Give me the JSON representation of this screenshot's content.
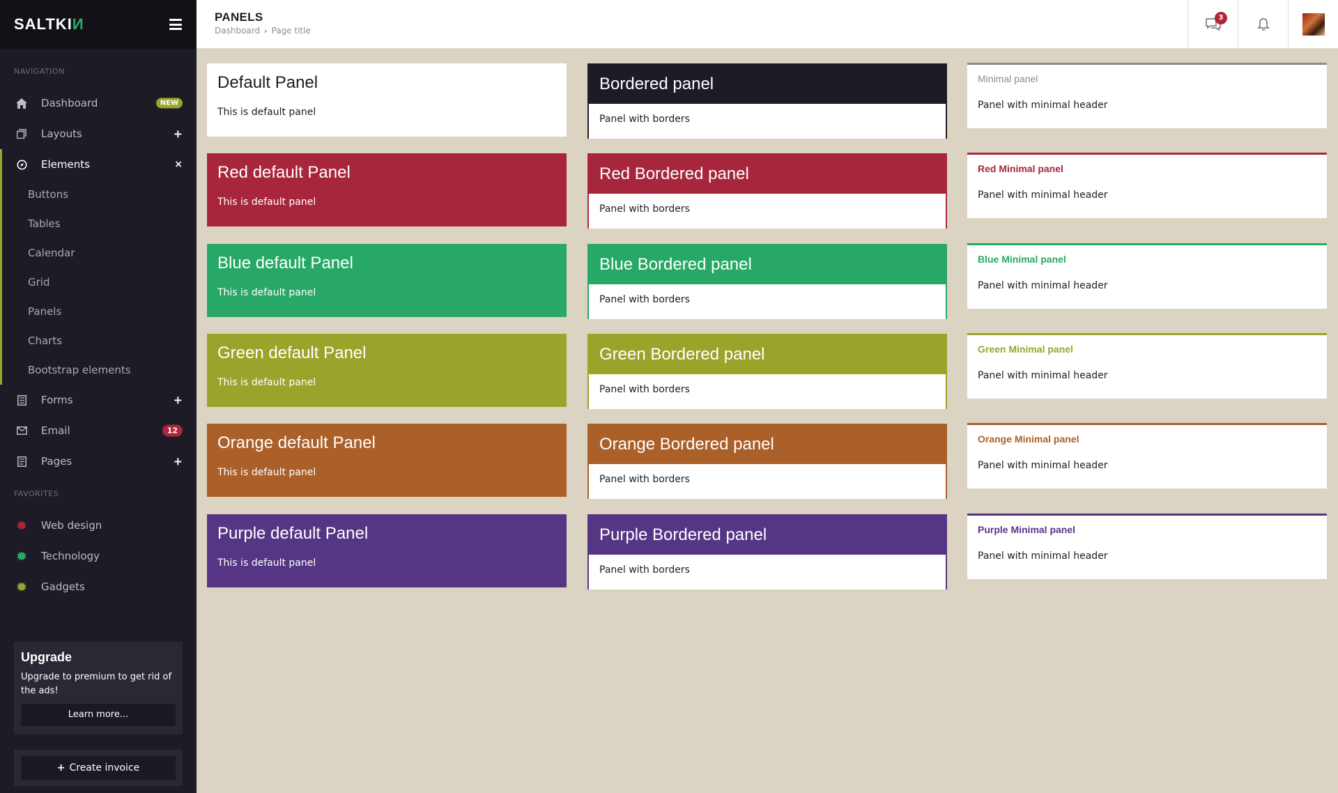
{
  "brand": {
    "name_main": "SALTKI",
    "name_accent": "И"
  },
  "nav": {
    "header": "NAVIGATION",
    "items": [
      {
        "label": "Dashboard",
        "icon": "home-icon",
        "badge": "NEW"
      },
      {
        "label": "Layouts",
        "icon": "layouts-icon",
        "toggle": "+"
      },
      {
        "label": "Elements",
        "icon": "elements-icon",
        "toggle": "×"
      }
    ],
    "subitems": [
      "Buttons",
      "Tables",
      "Calendar",
      "Grid",
      "Panels",
      "Charts",
      "Bootstrap elements"
    ],
    "items2": [
      {
        "label": "Forms",
        "icon": "forms-icon",
        "toggle": "+"
      },
      {
        "label": "Email",
        "icon": "email-icon",
        "badge": "12"
      },
      {
        "label": "Pages",
        "icon": "pages-icon",
        "toggle": "+"
      }
    ]
  },
  "favorites": {
    "header": "FAVORITES",
    "items": [
      {
        "label": "Web design",
        "color": "#b1243a"
      },
      {
        "label": "Technology",
        "color": "#2aaa68"
      },
      {
        "label": "Gadgets",
        "color": "#9aa52a"
      }
    ]
  },
  "upgrade": {
    "title": "Upgrade",
    "text": "Upgrade to premium to get rid of the ads!",
    "button": "Learn more..."
  },
  "create_invoice": "Create invoice",
  "topbar": {
    "title": "PANELS",
    "breadcrumb": [
      "Dashboard",
      "Page title"
    ],
    "messages_count": "3"
  },
  "panels": {
    "default": [
      {
        "title": "Default Panel",
        "body": "This is default panel",
        "color": "#ffffff",
        "text": "#1d1b26"
      },
      {
        "title": "Red default Panel",
        "body": "This is default panel",
        "color": "#a8263b",
        "text": "#ffffff"
      },
      {
        "title": "Blue default Panel",
        "body": "This is default panel",
        "color": "#28a867",
        "text": "#ffffff"
      },
      {
        "title": "Green default Panel",
        "body": "This is default panel",
        "color": "#9aa42a",
        "text": "#ffffff"
      },
      {
        "title": "Orange default Panel",
        "body": "This is default panel",
        "color": "#ab5f29",
        "text": "#ffffff"
      },
      {
        "title": "Purple default Panel",
        "body": "This is default panel",
        "color": "#553685",
        "text": "#ffffff"
      }
    ],
    "bordered": [
      {
        "title": "Bordered panel",
        "body": "Panel with borders",
        "color": "#1d1b26"
      },
      {
        "title": "Red Bordered panel",
        "body": "Panel with borders",
        "color": "#a8263b"
      },
      {
        "title": "Blue Bordered panel",
        "body": "Panel with borders",
        "color": "#28a867"
      },
      {
        "title": "Green Bordered panel",
        "body": "Panel with borders",
        "color": "#9aa42a"
      },
      {
        "title": "Orange Bordered panel",
        "body": "Panel with borders",
        "color": "#ab5f29"
      },
      {
        "title": "Purple Bordered panel",
        "body": "Panel with borders",
        "color": "#553685"
      }
    ],
    "minimal": [
      {
        "title": "Minimal panel",
        "body": "Panel with minimal header",
        "color": "#8c8a93",
        "border": "#8c8a93"
      },
      {
        "title": "Red Minimal panel",
        "body": "Panel with minimal header",
        "color": "#a8263b",
        "border": "#a8263b"
      },
      {
        "title": "Blue Minimal panel",
        "body": "Panel with minimal header",
        "color": "#28a867",
        "border": "#28a867"
      },
      {
        "title": "Green Minimal panel",
        "body": "Panel with minimal header",
        "color": "#9aa42a",
        "border": "#9aa42a"
      },
      {
        "title": "Orange Minimal panel",
        "body": "Panel with minimal header",
        "color": "#ab5f29",
        "border": "#ab5f29"
      },
      {
        "title": "Purple Minimal panel",
        "body": "Panel with minimal header",
        "color": "#553685",
        "border": "#553685"
      }
    ]
  }
}
